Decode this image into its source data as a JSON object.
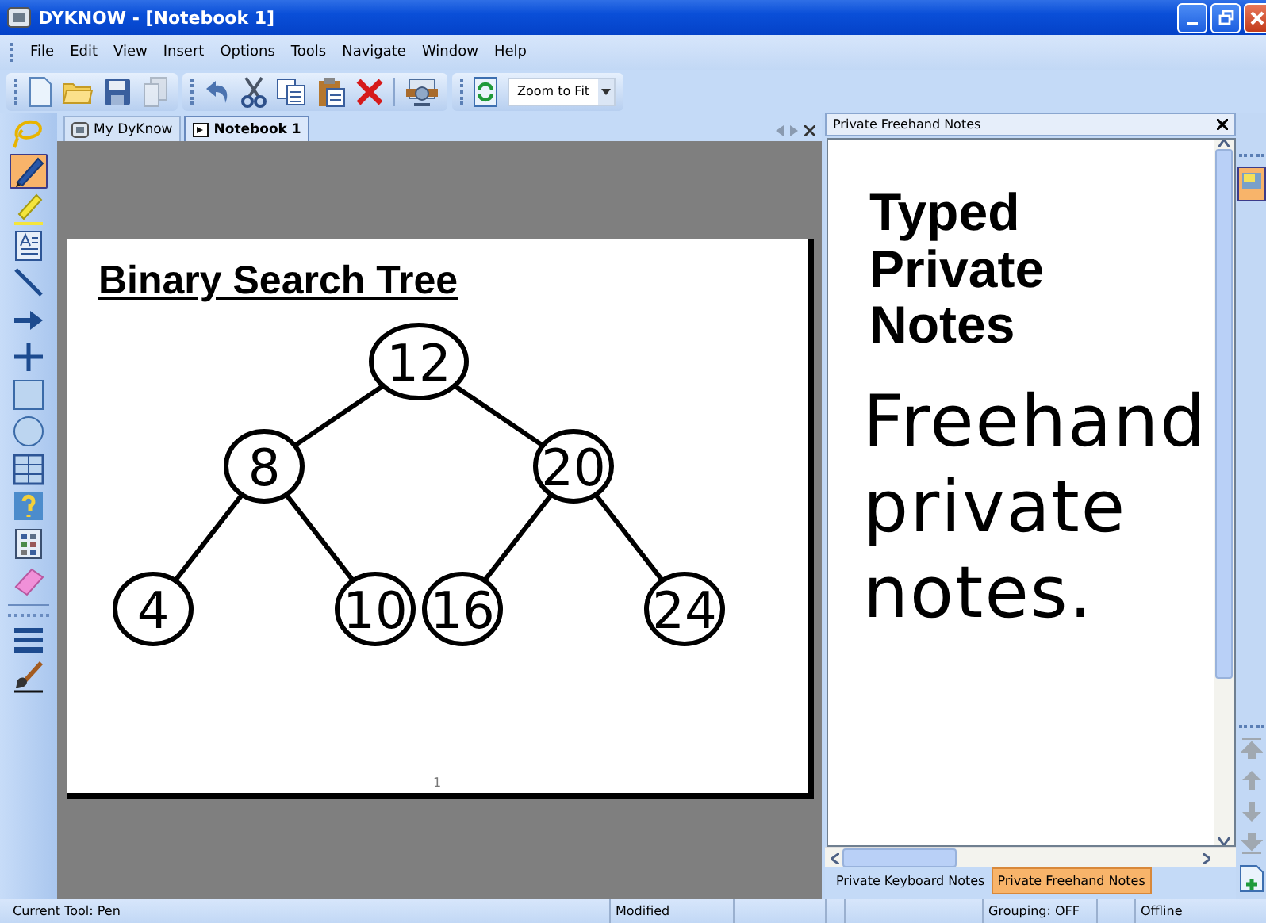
{
  "window": {
    "title": "DYKNOW - [Notebook 1]"
  },
  "menu": [
    "File",
    "Edit",
    "View",
    "Insert",
    "Options",
    "Tools",
    "Navigate",
    "Window",
    "Help"
  ],
  "toolbar": {
    "zoom": "Zoom to Fit"
  },
  "tools": [
    {
      "kind": "lasso",
      "selected": false
    },
    {
      "kind": "pen",
      "selected": true
    },
    {
      "kind": "highlighter",
      "selected": false
    },
    {
      "kind": "text",
      "selected": false
    },
    {
      "kind": "line",
      "selected": false
    },
    {
      "kind": "arrow",
      "selected": false
    },
    {
      "kind": "cross",
      "selected": false
    },
    {
      "kind": "rect",
      "selected": false
    },
    {
      "kind": "ellipse",
      "selected": false
    },
    {
      "kind": "table",
      "selected": false
    },
    {
      "kind": "question",
      "selected": false
    },
    {
      "kind": "palette",
      "selected": false
    },
    {
      "kind": "eraser",
      "selected": false
    },
    {
      "kind": "width",
      "selected": false
    },
    {
      "kind": "brush",
      "selected": false
    }
  ],
  "doc_tabs": [
    {
      "label": "My DyKnow",
      "selected": false
    },
    {
      "label": "Notebook 1",
      "selected": true
    }
  ],
  "slide": {
    "title": "Binary Search Tree",
    "page": "1",
    "tree": {
      "label": "12",
      "children": [
        {
          "label": "8",
          "children": [
            {
              "label": "4"
            },
            {
              "label": "10"
            }
          ]
        },
        {
          "label": "20",
          "children": [
            {
              "label": "16"
            },
            {
              "label": "24"
            }
          ]
        }
      ]
    }
  },
  "notes_pane": {
    "title": "Private Freehand Notes",
    "typed_notes": "Typed Private Notes",
    "freehand_notes": "Freehand private notes.",
    "tabs": [
      {
        "label": "Private Keyboard Notes",
        "selected": false
      },
      {
        "label": "Private Freehand Notes",
        "selected": true
      }
    ]
  },
  "status_bar": {
    "tool": "Current Tool: Pen",
    "modified": "Modified",
    "grouping": "Grouping: OFF",
    "connection": "Offline"
  }
}
